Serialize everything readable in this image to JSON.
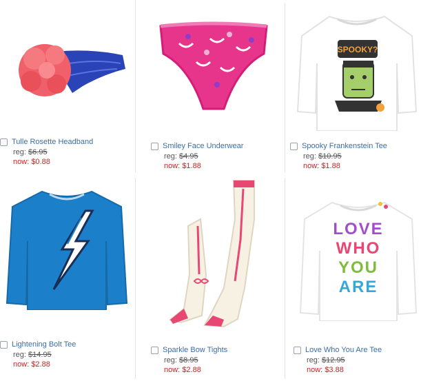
{
  "products": [
    {
      "name": "Tulle Rosette Headband",
      "reg_label": "reg:",
      "reg_price": "$6.95",
      "now_label": "now:",
      "now_price": "$0.88"
    },
    {
      "name": "Smiley Face Underwear",
      "reg_label": "reg:",
      "reg_price": "$4.95",
      "now_label": "now:",
      "now_price": "$1.88"
    },
    {
      "name": "Spooky Frankenstein Tee",
      "reg_label": "reg:",
      "reg_price": "$10.95",
      "now_label": "now:",
      "now_price": "$1.88"
    },
    {
      "name": "Lightening Bolt Tee",
      "reg_label": "reg:",
      "reg_price": "$14.95",
      "now_label": "now:",
      "now_price": "$2.88"
    },
    {
      "name": "Sparkle Bow Tights",
      "reg_label": "reg:",
      "reg_price": "$8.95",
      "now_label": "now:",
      "now_price": "$2.88"
    },
    {
      "name": "Love Who You Are Tee",
      "reg_label": "reg:",
      "reg_price": "$12.95",
      "now_label": "now:",
      "now_price": "$3.88"
    }
  ],
  "graphics": {
    "spooky_text": "SPOOKY?",
    "love_lines": [
      "LOVE",
      "WHO",
      "YOU",
      "ARE"
    ]
  },
  "colors": {
    "link": "#3a6ea5",
    "sale_price": "#cc2222",
    "headband_band": "#2a44b8",
    "headband_flower": "#f0606a",
    "underwear": "#e8358c",
    "bolt_tee": "#1c7fc9"
  }
}
